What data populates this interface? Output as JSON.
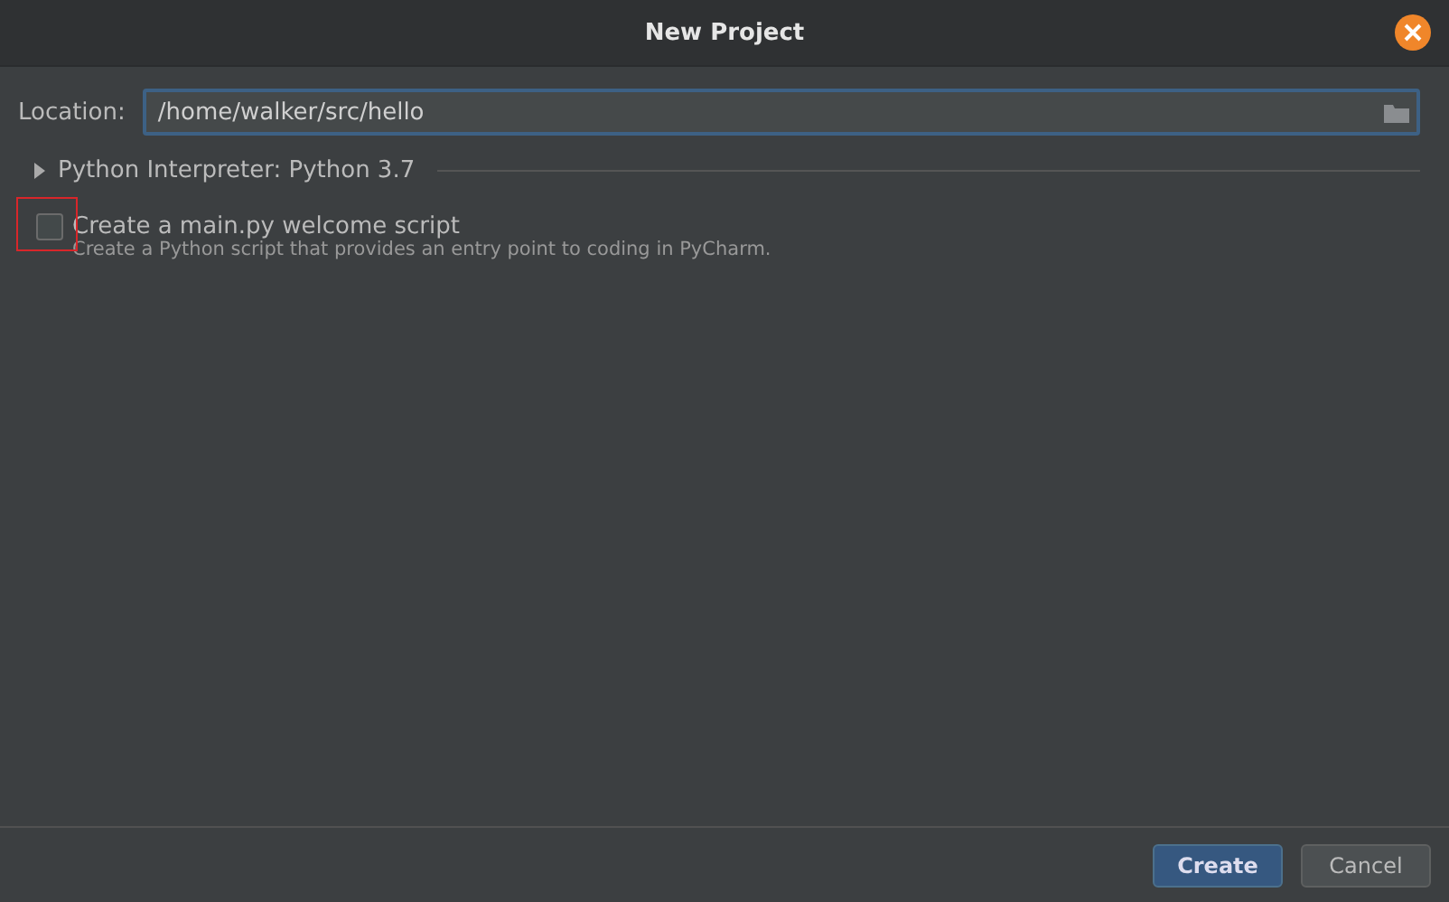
{
  "window": {
    "title": "New Project"
  },
  "location": {
    "label": "Location:",
    "value": "/home/walker/src/hello"
  },
  "interpreter": {
    "label": "Python Interpreter: Python 3.7",
    "expanded": false
  },
  "welcome_script": {
    "label": "Create a main.py welcome script",
    "description": "Create a Python script that provides an entry point to coding in PyCharm.",
    "checked": false,
    "focused": true
  },
  "buttons": [
    {
      "label": "Create",
      "kind": "primary"
    },
    {
      "label": "Cancel",
      "kind": "secondary"
    }
  ]
}
